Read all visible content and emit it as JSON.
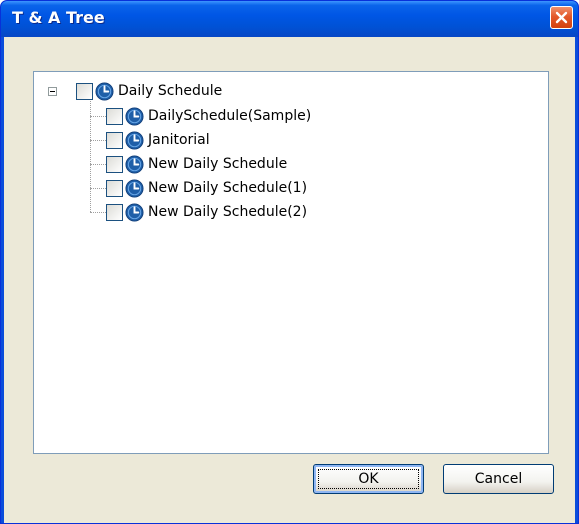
{
  "window": {
    "title": "T & A Tree",
    "close_icon": "close-icon"
  },
  "tree": {
    "root": {
      "label": "Daily Schedule",
      "expanded": true,
      "checked": false,
      "icon": "clock-icon"
    },
    "children": [
      {
        "label": "DailySchedule(Sample)",
        "checked": false,
        "icon": "clock-icon"
      },
      {
        "label": "Janitorial",
        "checked": false,
        "icon": "clock-icon"
      },
      {
        "label": "New Daily Schedule",
        "checked": false,
        "icon": "clock-icon"
      },
      {
        "label": "New Daily Schedule(1)",
        "checked": false,
        "icon": "clock-icon"
      },
      {
        "label": "New Daily Schedule(2)",
        "checked": false,
        "icon": "clock-icon"
      }
    ]
  },
  "buttons": {
    "ok_label": "OK",
    "cancel_label": "Cancel"
  },
  "colors": {
    "titlebar": "#0054e3",
    "client": "#ece9d8",
    "close_button": "#e3582a",
    "clock_icon": "#1f5fa8",
    "tree_border": "#7f9db9"
  }
}
